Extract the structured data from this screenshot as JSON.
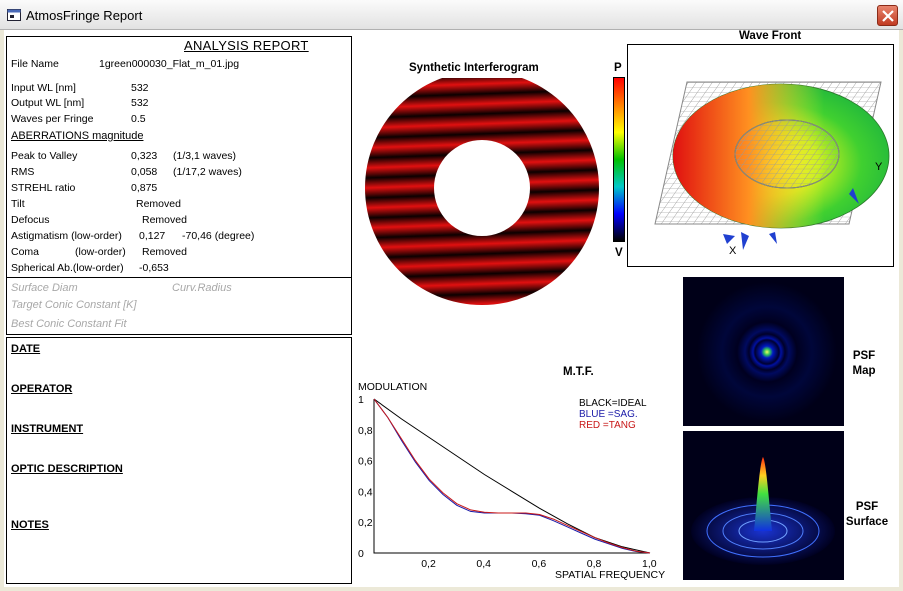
{
  "window": {
    "title": "AtmosFringe  Report",
    "close_icon": "close-icon",
    "app_icon": "app-window-icon"
  },
  "report": {
    "title": "ANALYSIS  REPORT",
    "file_name_label": "File Name",
    "file_name_value": "1green000030_Flat_m_01.jpg",
    "input_wl_label": "Input  WL [nm]",
    "input_wl_value": "532",
    "output_wl_label": "Output WL [nm]",
    "output_wl_value": "532",
    "waves_label": "Waves per Fringe",
    "waves_value": "0.5",
    "aberrations_heading": "ABERRATIONS magnitude",
    "ptv_label": "Peak to Valley",
    "ptv_value": "0,323",
    "ptv_extra": "(1/3,1 waves)",
    "rms_label": "RMS",
    "rms_value": "0,058",
    "rms_extra": "(1/17,2 waves)",
    "strehl_label": "STREHL ratio",
    "strehl_value": "0,875",
    "tilt_label": "Tilt",
    "tilt_value": "Removed",
    "defocus_label": "Defocus",
    "defocus_value": "Removed",
    "astig_label": "Astigmatism  (low-order)",
    "astig_value": "0,127",
    "astig_extra": "-70,46  (degree)",
    "coma_label": "Coma",
    "coma_order": "(low-order)",
    "coma_value": "Removed",
    "spherical_label": "Spherical Ab.(low-order)",
    "spherical_value": "-0,653",
    "surface_diam": "Surface Diam",
    "curv_radius": "Curv.Radius",
    "target_conic": "Target Conic Constant [K]",
    "best_conic": "Best Conic Constant Fit"
  },
  "info": {
    "date": "DATE",
    "operator": "OPERATOR",
    "instrument": "INSTRUMENT",
    "optic_description": "OPTIC DESCRIPTION",
    "notes": "NOTES"
  },
  "interferogram": {
    "title": "Synthetic Interferogram",
    "fringe_color": "#e21010"
  },
  "colorbar": {
    "top_label": "P",
    "bottom_label": "V"
  },
  "wavefront": {
    "title": "Wave Front",
    "x_label": "X",
    "y_label": "Y"
  },
  "psf": {
    "map_label_1": "PSF",
    "map_label_2": "Map",
    "surface_label_1": "PSF",
    "surface_label_2": "Surface"
  },
  "chart_data": {
    "type": "line",
    "title": "M.T.F.",
    "ylabel": "MODULATION",
    "xlabel": "SPATIAL FREQUENCY",
    "xlim": [
      0,
      1
    ],
    "ylim": [
      0,
      1
    ],
    "x_ticks": [
      "0,2",
      "0,4",
      "0,6",
      "0,8",
      "1,0"
    ],
    "y_ticks": [
      "0",
      "0,2",
      "0,4",
      "0,6",
      "0,8",
      "1"
    ],
    "legend": [
      "BLACK=IDEAL",
      "BLUE  =SAG.",
      "RED    =TANG"
    ],
    "series": [
      {
        "color": "#000000",
        "x": [
          0,
          0.1,
          0.2,
          0.3,
          0.4,
          0.5,
          0.6,
          0.7,
          0.8,
          0.9,
          1.0
        ],
        "y": [
          1,
          0.87,
          0.75,
          0.63,
          0.51,
          0.4,
          0.29,
          0.19,
          0.1,
          0.04,
          0
        ]
      },
      {
        "color": "#1a1aa8",
        "x": [
          0,
          0.05,
          0.1,
          0.15,
          0.2,
          0.25,
          0.3,
          0.35,
          0.4,
          0.45,
          0.5,
          0.55,
          0.6,
          0.65,
          0.7,
          0.75,
          0.8,
          0.85,
          0.9,
          0.95,
          1.0
        ],
        "y": [
          1,
          0.88,
          0.73,
          0.59,
          0.47,
          0.38,
          0.31,
          0.27,
          0.26,
          0.26,
          0.26,
          0.255,
          0.245,
          0.21,
          0.17,
          0.13,
          0.09,
          0.06,
          0.03,
          0.01,
          0
        ]
      },
      {
        "color": "#c81818",
        "x": [
          0,
          0.05,
          0.1,
          0.15,
          0.2,
          0.25,
          0.3,
          0.35,
          0.4,
          0.45,
          0.5,
          0.55,
          0.6,
          0.65,
          0.7,
          0.75,
          0.8,
          0.85,
          0.9,
          0.95,
          1.0
        ],
        "y": [
          1,
          0.88,
          0.74,
          0.6,
          0.48,
          0.39,
          0.32,
          0.28,
          0.265,
          0.26,
          0.26,
          0.26,
          0.25,
          0.22,
          0.18,
          0.14,
          0.1,
          0.065,
          0.035,
          0.012,
          0
        ]
      }
    ]
  }
}
